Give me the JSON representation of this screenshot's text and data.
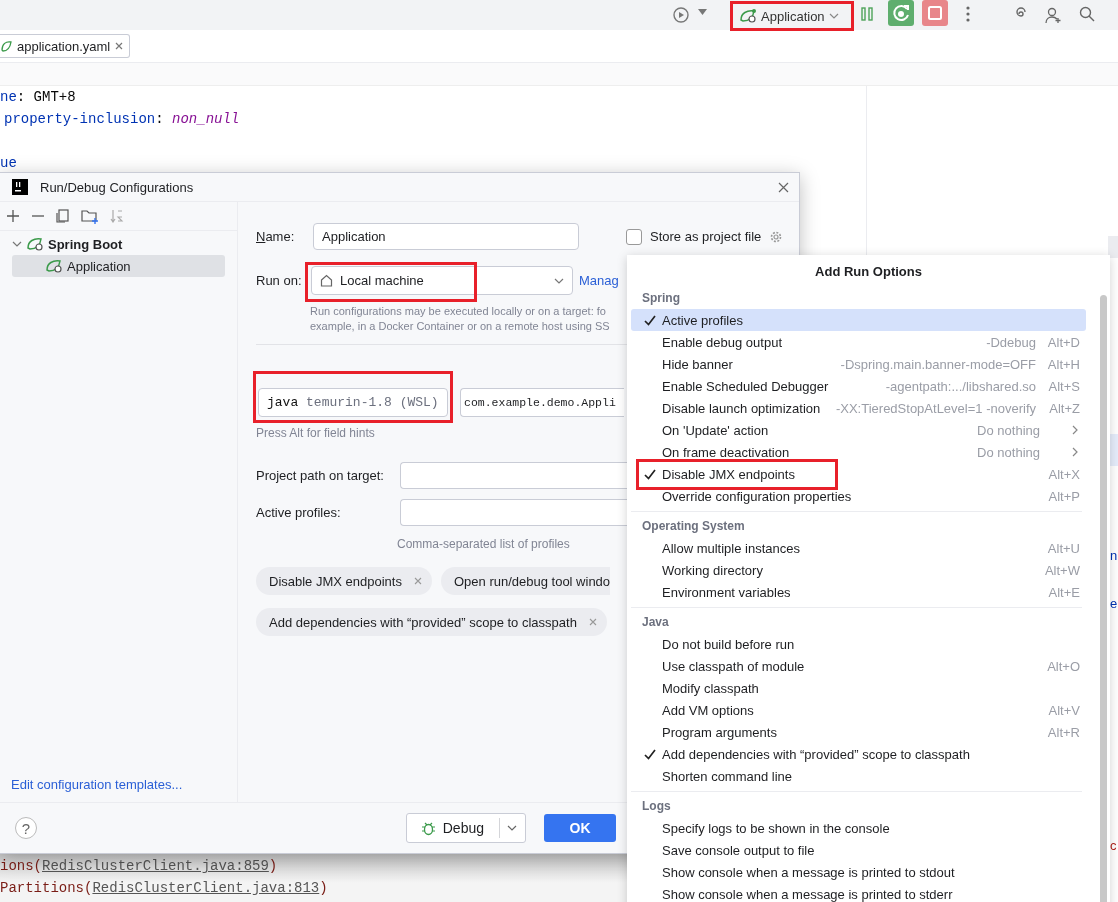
{
  "toolbar": {
    "run_config": {
      "label": "Application",
      "highlighted": true
    }
  },
  "editor": {
    "tab": {
      "label": "application.yaml"
    },
    "lines": [
      [
        {
          "kind": "key",
          "text": "ne"
        },
        {
          "kind": "plain",
          "text": ": GMT+8"
        }
      ],
      [
        {
          "kind": "key",
          "text": "property-inclusion"
        },
        {
          "kind": "plain",
          "text": ": "
        },
        {
          "kind": "value",
          "text": "non_null"
        }
      ],
      [
        {
          "kind": "key",
          "text": "ue",
          "spaced": true
        }
      ]
    ]
  },
  "dialog": {
    "title": "Run/Debug Configurations",
    "tree": [
      {
        "label": "Spring Boot",
        "expanded": true,
        "children": [
          {
            "label": "Application",
            "selected": true
          }
        ]
      }
    ],
    "templates_link": "Edit configuration templates...",
    "name": {
      "label": "Name:",
      "value": "Application"
    },
    "store": {
      "label": "Store as project file",
      "checked": false
    },
    "run_on": {
      "label": "Run on:",
      "value": "Local machine",
      "highlighted": true,
      "link": "Manag",
      "hint": [
        "Run configurations may be executed locally or on a target: fo",
        "example, in a Docker Container or on a remote host using SS"
      ]
    },
    "jre": {
      "name": "java",
      "version": "temurin-1.8 (WSL)",
      "highlighted": true
    },
    "main_class": "com.example.demo.Appli",
    "field_hint": "Press Alt for field hints",
    "project_path": {
      "label": "Project path on target:"
    },
    "active_profiles": {
      "label": "Active profiles:",
      "hint": "Comma-separated list of profiles"
    },
    "chips": [
      {
        "label": "Disable JMX endpoints",
        "closable": true
      },
      {
        "label": "Open run/debug tool windo",
        "closable": false
      },
      {
        "label": "Add dependencies with “provided” scope to classpath",
        "closable": true
      }
    ],
    "help_button": "?",
    "debug_button": "Debug",
    "ok_button": "OK"
  },
  "popup": {
    "title": "Add Run Options",
    "sections": [
      {
        "title": "Spring",
        "items": [
          {
            "kind": "option",
            "label": "Active profiles",
            "checked": true,
            "selected": true
          },
          {
            "kind": "option",
            "label": "Enable debug output",
            "hint": "-Ddebug",
            "shortcut": "Alt+D",
            "checked": false,
            "selected": false
          },
          {
            "kind": "option",
            "label": "Hide banner",
            "hint": "-Dspring.main.banner-mode=OFF",
            "shortcut": "Alt+H",
            "checked": false,
            "selected": false
          },
          {
            "kind": "option",
            "label": "Enable Scheduled Debugger",
            "hint": "-agentpath:.../libshared.so",
            "shortcut": "Alt+S",
            "checked": false,
            "selected": false
          },
          {
            "kind": "option",
            "label": "Disable launch optimization",
            "hint": "-XX:TieredStopAtLevel=1 -noverify",
            "shortcut": "Alt+Z",
            "checked": false,
            "selected": false
          },
          {
            "kind": "submenu",
            "label": "On 'Update' action",
            "hint": "Do nothing",
            "checked": false,
            "selected": false
          },
          {
            "kind": "submenu",
            "label": "On frame deactivation",
            "hint": "Do nothing",
            "checked": false,
            "selected": false
          },
          {
            "kind": "option",
            "label": "Disable JMX endpoints",
            "shortcut": "Alt+X",
            "checked": true,
            "selected": false,
            "highlighted": true
          },
          {
            "kind": "option",
            "label": "Override configuration properties",
            "shortcut": "Alt+P",
            "checked": false,
            "selected": false
          }
        ]
      },
      {
        "title": "Operating System",
        "items": [
          {
            "kind": "option",
            "label": "Allow multiple instances",
            "shortcut": "Alt+U",
            "checked": false,
            "selected": false
          },
          {
            "kind": "option",
            "label": "Working directory",
            "shortcut": "Alt+W",
            "checked": false,
            "selected": false
          },
          {
            "kind": "option",
            "label": "Environment variables",
            "shortcut": "Alt+E",
            "checked": false,
            "selected": false
          }
        ]
      },
      {
        "title": "Java",
        "items": [
          {
            "kind": "option",
            "label": "Do not build before run",
            "checked": false,
            "selected": false
          },
          {
            "kind": "option",
            "label": "Use classpath of module",
            "shortcut": "Alt+O",
            "checked": false,
            "selected": false
          },
          {
            "kind": "option",
            "label": "Modify classpath",
            "checked": false,
            "selected": false
          },
          {
            "kind": "option",
            "label": "Add VM options",
            "shortcut": "Alt+V",
            "checked": false,
            "selected": false
          },
          {
            "kind": "option",
            "label": "Program arguments",
            "shortcut": "Alt+R",
            "checked": false,
            "selected": false
          },
          {
            "kind": "option",
            "label": "Add dependencies with “provided” scope to classpath",
            "checked": true,
            "selected": false
          },
          {
            "kind": "option",
            "label": "Shorten command line",
            "checked": false,
            "selected": false
          }
        ]
      },
      {
        "title": "Logs",
        "items": [
          {
            "kind": "option",
            "label": "Specify logs to be shown in the console",
            "checked": false,
            "selected": false
          },
          {
            "kind": "option",
            "label": "Save console output to file",
            "checked": false,
            "selected": false
          },
          {
            "kind": "option",
            "label": "Show console when a message is printed to stdout",
            "checked": false,
            "selected": false
          },
          {
            "kind": "option",
            "label": "Show console when a message is printed to stderr",
            "checked": false,
            "selected": false
          }
        ]
      }
    ]
  },
  "console": [
    {
      "prefix": "ions(",
      "link": "RedisClusterClient.java:859",
      "suffix": ")"
    },
    {
      "prefix": "Partitions(",
      "link": "RedisClusterClient.java:813",
      "suffix": ")"
    }
  ],
  "edge_fragments": [
    {
      "text": "n",
      "kind": "plain"
    },
    {
      "text": "e",
      "kind": "plain"
    },
    {
      "text": "c",
      "kind": "error"
    }
  ]
}
